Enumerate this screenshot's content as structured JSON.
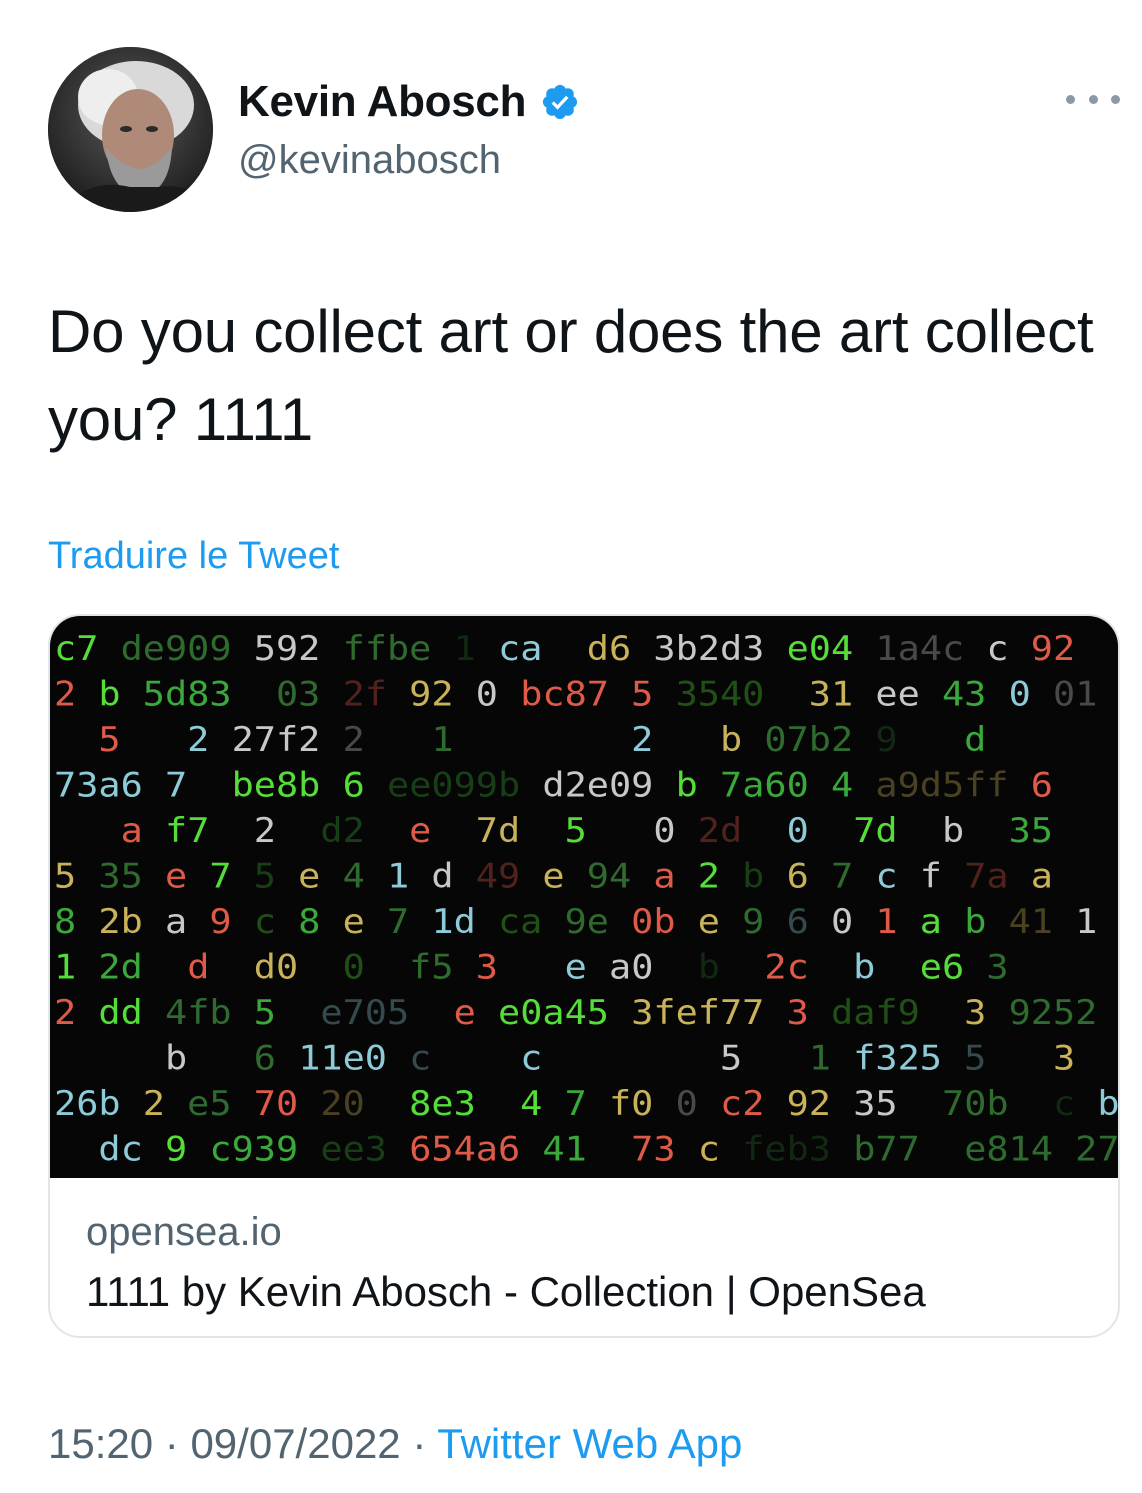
{
  "author": {
    "display_name": "Kevin Abosch",
    "handle": "@kevinabosch",
    "verified_icon": "verified-badge-icon",
    "verified_color": "#1d9bf0"
  },
  "tweet": {
    "text": "Do you collect art or does the art collect you? 1111",
    "translate_label": "Traduire le Tweet"
  },
  "card": {
    "domain": "opensea.io",
    "title": "1111 by Kevin Abosch - Collection | OpenSea",
    "image_rows": [
      "c7 de909 592 ffbe 1 ca  d6 3b2d3 e04 1a4c c 92",
      "2 b 5d83  03 2f 92 0 bc87 5 3540  31 ee 43 0 01",
      "  5   2 27f2 2   1        2   b 07b2 9   d",
      "73a6 7  be8b 6 ee099b d2e09 b 7a60 4 a9d5ff 6",
      "   a f7  2  d2  e  7d  5   0 2d  0  7d  b  35",
      "5 35 e 7 5 e 4 1 d 49 e 94 a 2 b 6 7 c f 7a a",
      "8 2b a 9 c 8 e 7 1d ca 9e 0b e 9 6 0 1 a b 41 1",
      "1 2d  d  d0  0  f5 3   e a0  b  2c  b  e6 3",
      "2 dd 4fb 5  e705  e e0a45 3fef77 3 daf9  3 9252",
      "     b   6 11e0 c    c        5   1 f325 5   3",
      "26b 2 e5 70 20  8e3  4 7 f0 0 c2 92 35  70b  c b",
      "  dc 9 c939 ee3 654a6 41  73 c feb3 b77  e814 27"
    ],
    "image_colors": [
      "#55dd3a",
      "#c9b25a",
      "#8ecbd8",
      "#e05a4a",
      "#3aa83a",
      "#2f6b2f",
      "#c8c8c8"
    ]
  },
  "footer": {
    "time": "15:20",
    "date": "09/07/2022",
    "separator": "·",
    "app": "Twitter Web App"
  }
}
